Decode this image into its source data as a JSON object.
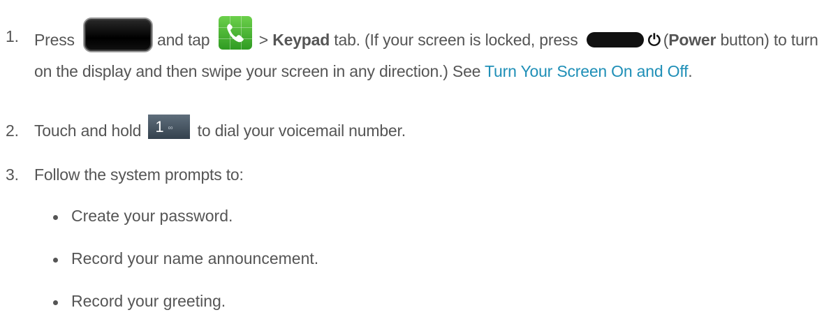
{
  "steps": [
    {
      "number": "1.",
      "text_press": "Press",
      "text_and_tap": "and tap",
      "text_gt": ">",
      "keypad_bold": "Keypad",
      "text_tab_locked": "tab. (If your screen is locked, press",
      "power_bold": "Power",
      "text_power_rest": "button) to turn on the display and then swipe your screen in any direction.) See",
      "link_text": "Turn Your Screen On and Off",
      "text_end": "."
    },
    {
      "number": "2.",
      "text_touch": "Touch and hold",
      "key_label": "1",
      "key_sub": "∞",
      "text_rest": "to dial your voicemail number."
    },
    {
      "number": "3.",
      "text": "Follow the system prompts to:"
    }
  ],
  "bullets": [
    "Create your password.",
    "Record your name announcement.",
    "Record your greeting."
  ],
  "icons": {
    "home_key": "home-key-icon",
    "phone_app": "phone-app-icon",
    "power_key": "power-key-icon",
    "power_symbol": "power-symbol-icon",
    "key_one": "dialpad-key-one-icon"
  },
  "colors": {
    "text": "#555555",
    "link": "#1f8fb7",
    "phone_green": "#4cb83a"
  }
}
